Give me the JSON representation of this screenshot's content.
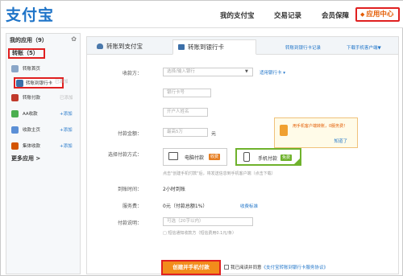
{
  "header": {
    "logo": "支付宝",
    "nav": [
      "我的支付宝",
      "交易记录",
      "会员保障"
    ],
    "active_nav": "应用中心"
  },
  "sidebar": {
    "title": "我的应用（9）",
    "group": "转账（5）",
    "items": [
      {
        "label": "转账首页",
        "action": ""
      },
      {
        "label": "转账到银行卡",
        "action": "已添加"
      },
      {
        "label": "转账付款",
        "action": "已添加"
      },
      {
        "label": "AA收款",
        "action": "+添加"
      },
      {
        "label": "收款主页",
        "action": "+添加"
      },
      {
        "label": "集体收款",
        "action": "+添加"
      }
    ],
    "more": "更多应用 >"
  },
  "tabs": {
    "tab1": "转账到支付宝",
    "tab2": "转账到银行卡",
    "link1": "转账到银行卡记录",
    "link2": "下载手机客户端▼"
  },
  "form": {
    "payee_label": "收款方：",
    "bank_placeholder": "选择/输入银行",
    "bank_help": "适用银行卡 ▾",
    "card_placeholder": "银行卡号",
    "name_placeholder": "开户人姓名",
    "amount_label": "付款金额：",
    "amount_placeholder": "最高5万",
    "amount_unit": "元",
    "method_label": "选择付款方式：",
    "pc_pay": "电脑付款",
    "pc_badge": "收费",
    "mobile_pay": "手机付款",
    "mobile_badge": "免费",
    "method_hint": "点击\"创建手机付款\"后，将发送信息到手机客户端（点击下载）",
    "arrival_label": "到账时间：",
    "arrival_value": "2小时到账",
    "fee_label": "服务费：",
    "fee_value": "0元（付款总额1%）",
    "fee_link": "收费标准",
    "memo_label": "付款说明：",
    "memo_placeholder": "可选（20字以内）",
    "notify_hint": "□ 短信通知收款方（短信费用0.1元/条）",
    "submit": "创建并手机付款",
    "agree_text": "我已阅读并同意",
    "agree_link": "《支付宝转账到银行卡服务协议》"
  },
  "promo": {
    "text": "用手机客户端转账，0服务费！",
    "link": "知道了"
  },
  "colors": {
    "brand_blue": "#1f74c8",
    "accent_orange": "#f28c1b",
    "highlight_red": "#e02020",
    "select_green": "#6fb22c"
  }
}
